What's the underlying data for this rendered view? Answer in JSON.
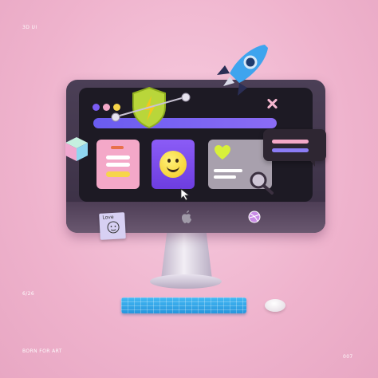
{
  "labels": {
    "top": "3D UI",
    "page": "6/26",
    "tagline": "BORN FOR ART",
    "number": "007"
  },
  "sticky_note": {
    "text": "Love"
  },
  "colors": {
    "background": "#efb3cd",
    "monitor": "#3a2f44",
    "accent_purple": "#6d3de0",
    "accent_pink": "#f4a8c8",
    "accent_blue": "#2796dd",
    "accent_yellow": "#f3c81d"
  },
  "icons": [
    "rocket-icon",
    "shield-icon",
    "close-icon",
    "smiley-icon",
    "heart-icon",
    "cursor-icon",
    "search-icon",
    "apple-logo-icon",
    "cube-icon"
  ]
}
